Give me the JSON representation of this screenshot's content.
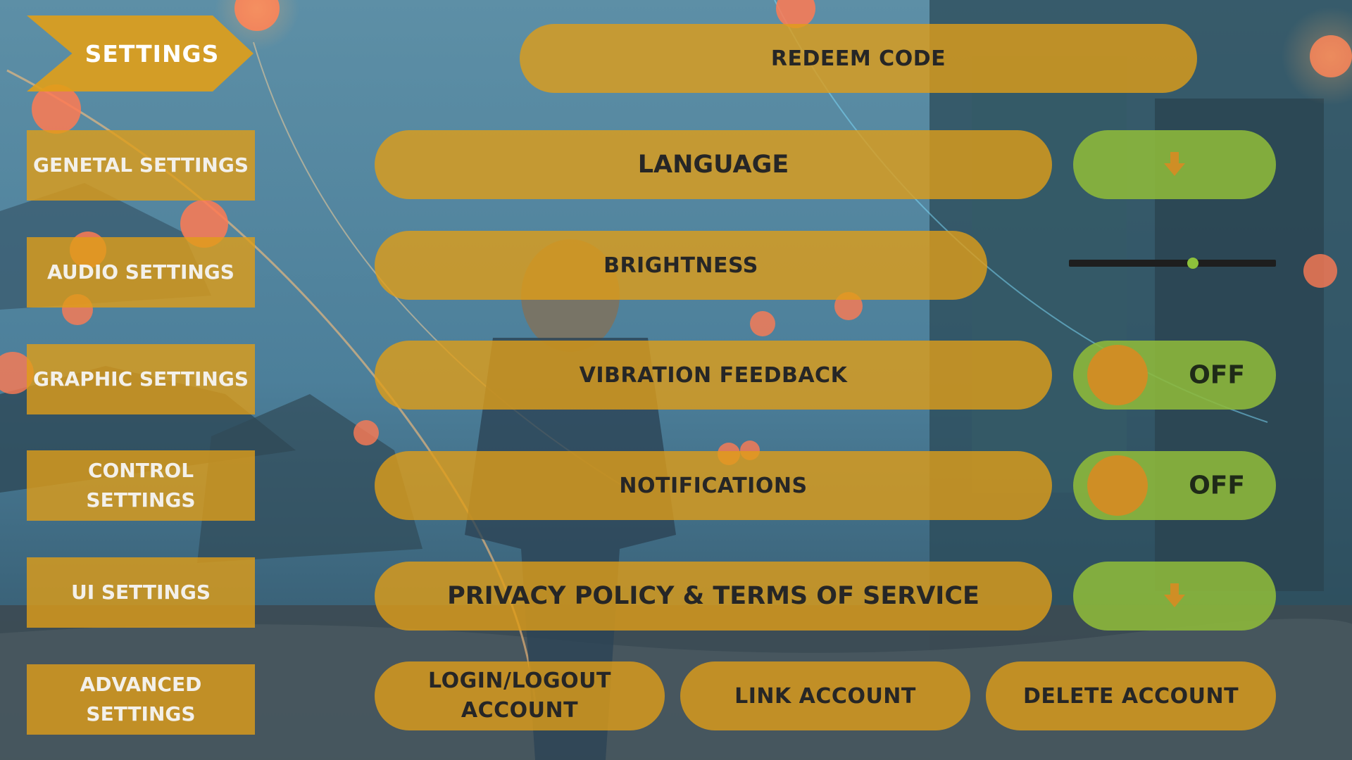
{
  "title": "SETTINGS",
  "sidebar": {
    "items": [
      {
        "label": "GENETAL SETTINGS"
      },
      {
        "label": "AUDIO SETTINGS"
      },
      {
        "label": "GRAPHIC SETTINGS"
      },
      {
        "label": "CONTROL SETTINGS"
      },
      {
        "label": "UI SETTINGS"
      },
      {
        "label": "ADVANCED SETTINGS"
      }
    ]
  },
  "settings": {
    "redeem_code": "REDEEM CODE",
    "language": "LANGUAGE",
    "brightness": {
      "label": "BRIGHTNESS",
      "value": 0.6
    },
    "vibration": {
      "label": "VIBRATION FEEDBACK",
      "state": "OFF"
    },
    "notifications": {
      "label": "NOTIFICATIONS",
      "state": "OFF"
    },
    "privacy": "PRIVACY POLICY & TERMS OF SERVICE"
  },
  "account": {
    "login_logout": "LOGIN/LOGOUT ACCOUNT",
    "link": "LINK ACCOUNT",
    "delete": "DELETE ACCOUNT"
  },
  "colors": {
    "panel": "#e09e18",
    "toggle": "#8eba3a",
    "knob": "#cf8e25",
    "slider_track": "#1e1e1e",
    "slider_thumb": "#8dc13b"
  }
}
